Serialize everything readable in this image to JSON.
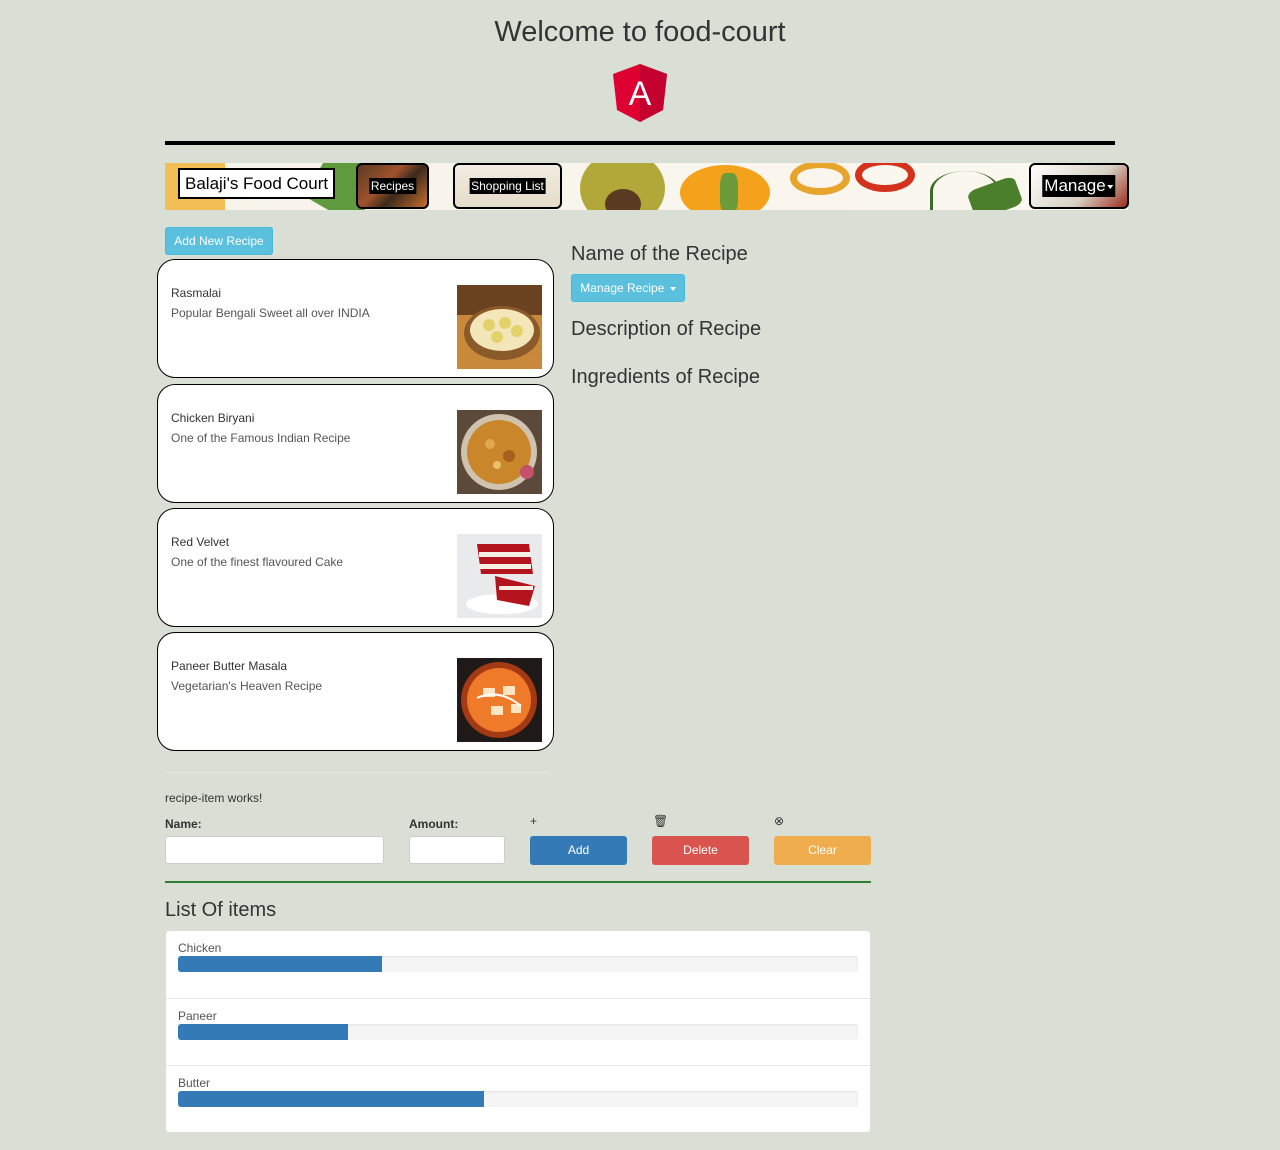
{
  "header": {
    "title": "Welcome to food-court",
    "logo_letter": "A"
  },
  "navbar": {
    "brand": "Balaji's Food Court",
    "recipes_label": "Recipes",
    "shopping_label": "Shopping List",
    "manage_label": "Manage"
  },
  "recipes": {
    "add_button": "Add New Recipe",
    "items": [
      {
        "name": "Rasmalai",
        "description": "Popular Bengali Sweet all over INDIA",
        "image_icon": "rasmalai-bowl"
      },
      {
        "name": "Chicken Biryani",
        "description": "One of the Famous Indian Recipe",
        "image_icon": "biryani-plate"
      },
      {
        "name": "Red Velvet",
        "description": "One of the finest flavoured Cake",
        "image_icon": "red-velvet-cake"
      },
      {
        "name": "Paneer Butter Masala",
        "description": "Vegetarian's Heaven Recipe",
        "image_icon": "paneer-bowl"
      }
    ]
  },
  "detail": {
    "name": "Name of the Recipe",
    "manage_button": "Manage Recipe",
    "description": "Description of Recipe",
    "ingredients": "Ingredients of Recipe"
  },
  "recipe_item_text": "recipe-item works!",
  "shopping_edit": {
    "name_label": "Name:",
    "amount_label": "Amount:",
    "name_value": "",
    "amount_value": "",
    "add_icon": "+",
    "delete_icon": "🗑",
    "clear_icon": "⊗",
    "add_label": "Add",
    "delete_label": "Delete",
    "clear_label": "Clear"
  },
  "shopping_list": {
    "title": "List Of items",
    "items": [
      {
        "name": "Chicken",
        "progress": 0.3
      },
      {
        "name": "Paneer",
        "progress": 0.25
      },
      {
        "name": "Butter",
        "progress": 0.45
      }
    ]
  },
  "colors": {
    "background": "#dadfd6",
    "info": "#5bc0de",
    "primary": "#337ab7",
    "danger": "#d9534f",
    "warning": "#f0ad4e",
    "angular_red": "#dd0031"
  }
}
